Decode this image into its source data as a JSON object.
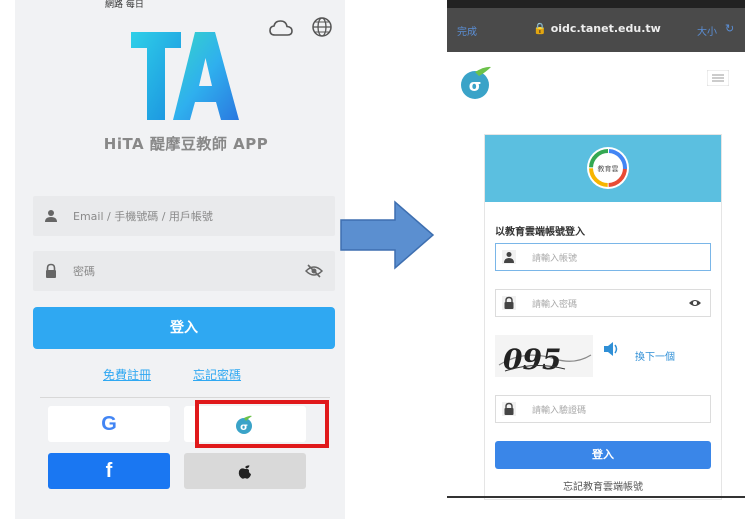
{
  "left_app": {
    "status_text": "網路 每日",
    "title": "HiTA 醍摩豆教師 APP",
    "logo_text": "TA",
    "account_placeholder": "Email / 手機號碼 / 用戶帳號",
    "password_placeholder": "密碼",
    "login_button": "登入",
    "register_link": "免費註冊",
    "forgot_link": "忘記密碼",
    "google_label": "G",
    "facebook_label": "f",
    "apple_label": "",
    "icons": [
      "cloud-icon",
      "globe-icon",
      "user-icon",
      "lock-icon",
      "eye-off-icon",
      "oidc-icon",
      "apple-icon"
    ]
  },
  "browser": {
    "done_label": "完成",
    "url": "oidc.tanet.edu.tw",
    "text_size_label": "大小",
    "reload_label": "↻"
  },
  "oidc_page": {
    "badge_text": "教育雲",
    "section_title": "以教育雲端帳號登入",
    "account_placeholder": "請輸入帳號",
    "password_placeholder": "請輸入密碼",
    "captcha_text": "095",
    "refresh_captcha": "換下一個",
    "captcha_placeholder": "請輸入驗證碼",
    "login_button": "登入",
    "forgot_account_link": "忘記教育雲端帳號"
  },
  "colors": {
    "primary_blue": "#2fa8f2",
    "oidc_header": "#5bbfe0",
    "highlight_red": "#e0191b",
    "facebook_blue": "#1a77f2",
    "arrow_blue": "#5b8fd0"
  }
}
